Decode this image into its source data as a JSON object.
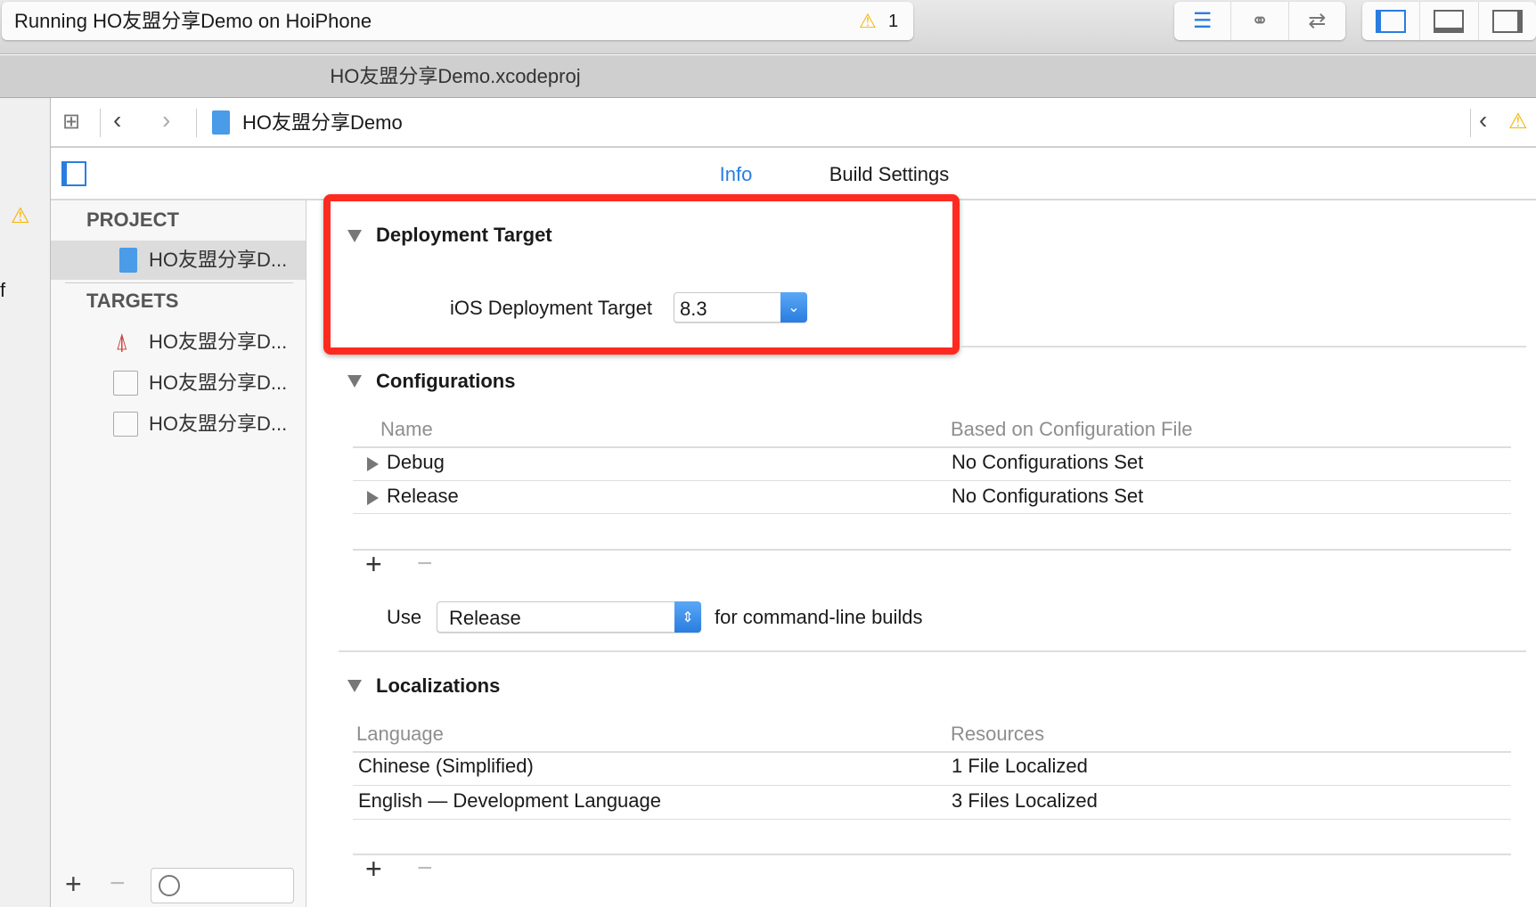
{
  "toolbar": {
    "status_text": "Running HO友盟分享Demo on HoiPhone",
    "warning_count": "1"
  },
  "tab": {
    "title": "HO友盟分享Demo.xcodeproj"
  },
  "jumpbar": {
    "project": "HO友盟分享Demo"
  },
  "editor_tabs": [
    {
      "label": "Info",
      "selected": true
    },
    {
      "label": "Build Settings",
      "selected": false
    }
  ],
  "sidebar": {
    "project_header": "PROJECT",
    "project_item": "HO友盟分享D...",
    "targets_header": "TARGETS",
    "targets": [
      "HO友盟分享D...",
      "HO友盟分享D...",
      "HO友盟分享D..."
    ]
  },
  "deployment": {
    "title": "Deployment Target",
    "label": "iOS Deployment Target",
    "value": "8.3"
  },
  "configurations": {
    "title": "Configurations",
    "col_name": "Name",
    "col_file": "Based on Configuration File",
    "rows": [
      {
        "name": "Debug",
        "file": "No Configurations Set"
      },
      {
        "name": "Release",
        "file": "No Configurations Set"
      }
    ],
    "use_label": "Use",
    "use_value": "Release",
    "use_suffix": "for command-line builds"
  },
  "localizations": {
    "title": "Localizations",
    "col_language": "Language",
    "col_resources": "Resources",
    "rows": [
      {
        "language": "Chinese (Simplified)",
        "resources": "1 File Localized"
      },
      {
        "language": "English — Development Language",
        "resources": "3 Files Localized"
      }
    ]
  },
  "leftstrip": {
    "fragment": "f"
  },
  "colors": {
    "accent": "#2a7de0",
    "highlight": "#ff2a1f",
    "warning": "#f5b400"
  }
}
